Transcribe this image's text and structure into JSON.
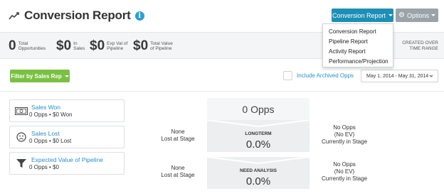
{
  "header": {
    "title": "Conversion Report",
    "report_button": "Conversion Report",
    "options_button": "Options"
  },
  "stats": [
    {
      "value": "0",
      "label_line1": "Total",
      "label_line2": "Opportunities"
    },
    {
      "value": "$0",
      "label_line1": "In",
      "label_line2": "Sales"
    },
    {
      "value": "$0",
      "label_line1": "Exp Val of",
      "label_line2": "Pipeline"
    },
    {
      "value": "$0",
      "label_line1": "Total Value",
      "label_line2": "of Pipeline"
    }
  ],
  "created_over": {
    "line1": "CREATED OVER",
    "line2": "TIME RANGE"
  },
  "report_menu": {
    "items": [
      "Conversion Report",
      "Pipeline Report",
      "Activity Report",
      "Performance/Projection"
    ]
  },
  "filters": {
    "filter_button": "Filter by Sales Rep",
    "archived_label": "Include Archived Opps",
    "date_range": "May 1, 2014 - May 31, 2014"
  },
  "cards": [
    {
      "title": "Sales Won",
      "sub": "0 Opps • $0 Won",
      "icon": "money-icon"
    },
    {
      "title": "Sales Lost",
      "sub": "0 Opps • $0 Lost",
      "icon": "sad-face-icon"
    },
    {
      "title": "Expected Value of Pipeline",
      "sub": "0 Opps • $0",
      "icon": "funnel-icon"
    }
  ],
  "funnel": {
    "header": "0 Opps",
    "stages": [
      {
        "name": "LONGTERM",
        "pct": "0.0%",
        "lost_line1": "None",
        "lost_line2": "Lost at Stage",
        "right_line1": "No Opps",
        "right_line2": "(No EV)",
        "right_line3": "Currently in Stage"
      },
      {
        "name": "NEED ANALYSIS",
        "pct": "0.0%",
        "lost_line1": "None",
        "lost_line2": "Lost at Stage",
        "right_line1": "No Opps",
        "right_line2": "(No EV)",
        "right_line3": "Currently in Stage"
      }
    ]
  },
  "colors": {
    "report_button": "#1d8fb6",
    "options_button": "#9aa3a9",
    "filter_button": "#7ac142",
    "link": "#2a8fc9"
  }
}
